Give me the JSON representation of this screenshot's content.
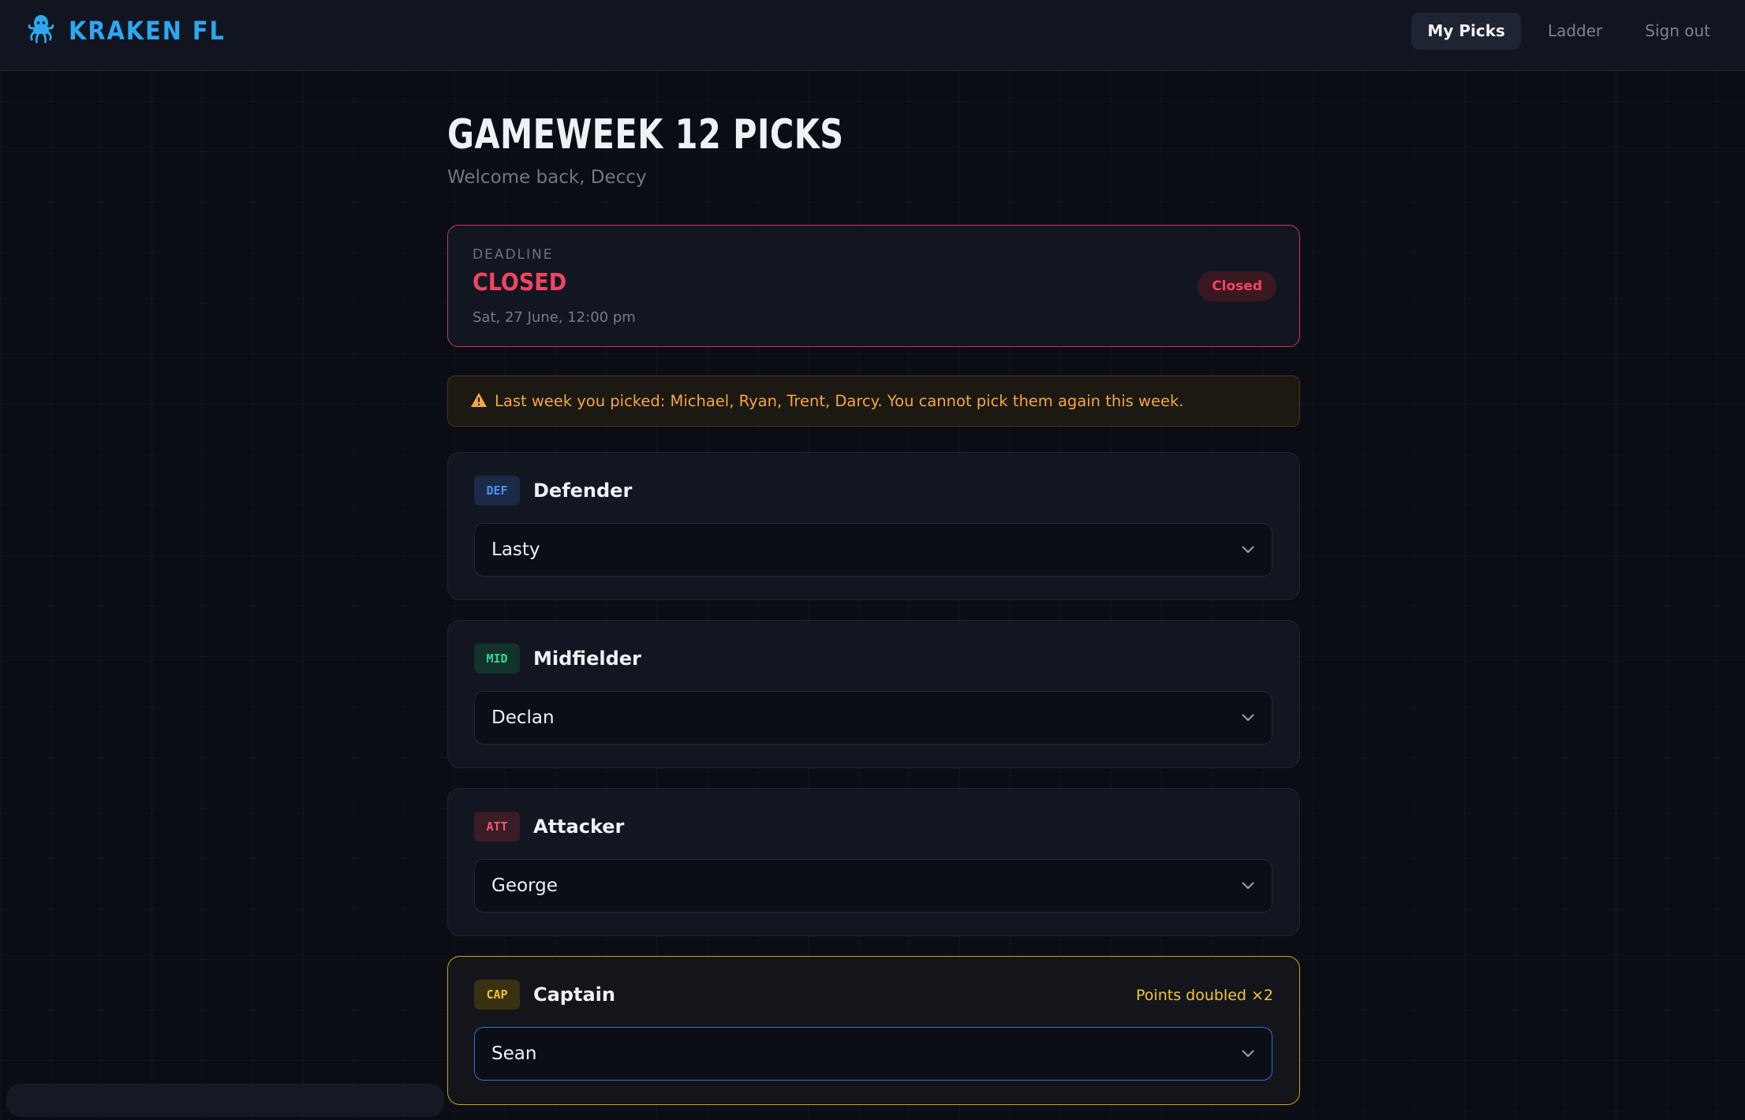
{
  "app": {
    "brand": "KRAKEN FL",
    "logo_icon": "kraken-icon",
    "accent": "#2ba8f0"
  },
  "nav": {
    "items": [
      {
        "label": "My Picks",
        "active": true
      },
      {
        "label": "Ladder",
        "active": false
      },
      {
        "label": "Sign out",
        "active": false
      }
    ]
  },
  "page": {
    "title": "GAMEWEEK 12 PICKS",
    "welcome": "Welcome back, Deccy"
  },
  "deadline": {
    "label": "DEADLINE",
    "status": "CLOSED",
    "date": "Sat, 27 June, 12:00 pm",
    "badge": "Closed",
    "color": "#f0455f"
  },
  "warning": {
    "icon": "warning-icon",
    "text": "Last week you picked: Michael, Ryan, Trent, Darcy. You cannot pick them again this week."
  },
  "picks": [
    {
      "tag": "DEF",
      "title": "Defender",
      "value": "Lasty",
      "note": ""
    },
    {
      "tag": "MID",
      "title": "Midfielder",
      "value": "Declan",
      "note": ""
    },
    {
      "tag": "ATT",
      "title": "Attacker",
      "value": "George",
      "note": ""
    },
    {
      "tag": "CAP",
      "title": "Captain",
      "value": "Sean",
      "note": "Points doubled ×2"
    }
  ]
}
